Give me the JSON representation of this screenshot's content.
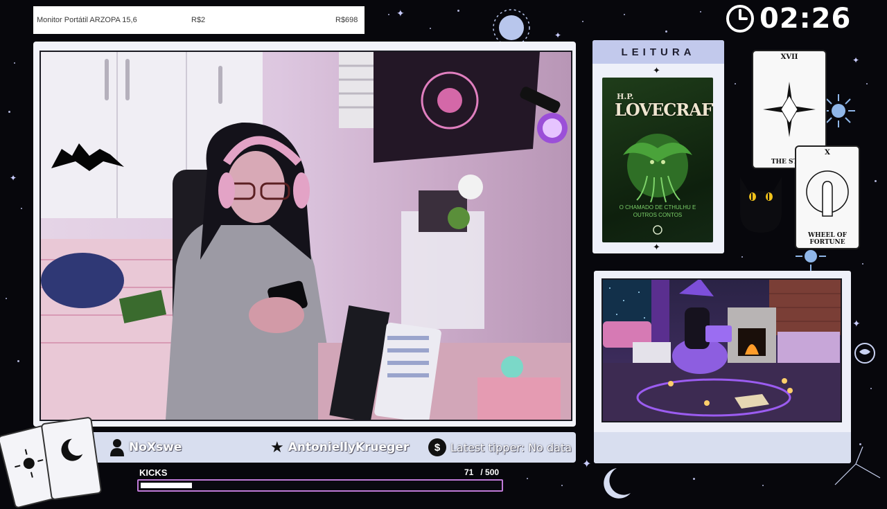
{
  "goal": {
    "item": "Monitor Portátil ARZOPA 15,6",
    "current": "R$2",
    "target": "R$698"
  },
  "clock": {
    "time": "02:26"
  },
  "namebar": {
    "follower": "NoXswe",
    "subscriber": "AntoniellyKrueger",
    "tipper": "Latest tipper: No data"
  },
  "kicks": {
    "label": "KICKS",
    "count": "71   / 500",
    "progress_percent": 14.2
  },
  "reading": {
    "header": "LEITURA",
    "book_author": "H.P.",
    "book_title": "LOVECRAFT",
    "book_subtitle": "O CHAMADO DE CTHULHU E OUTROS CONTOS"
  },
  "tarot": [
    {
      "number": "XVII",
      "name": "THE STAR"
    },
    {
      "number": "X",
      "name": "WHEEL OF FORTUNE"
    }
  ],
  "colors": {
    "background": "#07070c",
    "frame": "#f2f3fa",
    "accent": "#c2c9ec",
    "kicks_border": "#c07ad8"
  }
}
